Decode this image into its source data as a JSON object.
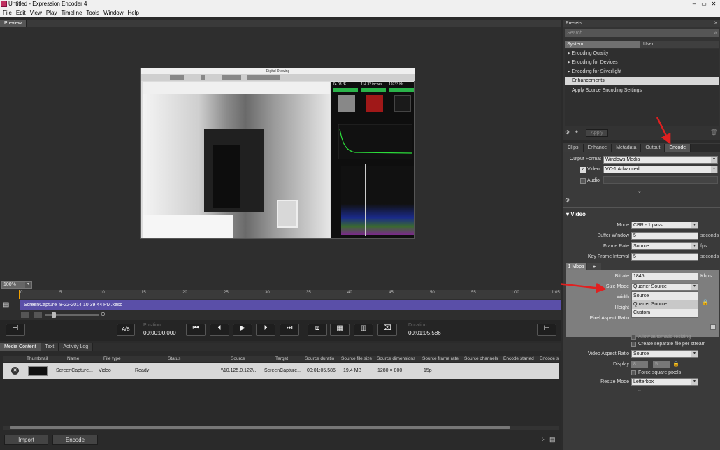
{
  "app": {
    "title": "Untitled - Expression Encoder 4"
  },
  "window_controls": {
    "minimize": "–",
    "maximize": "▭",
    "close": "✕"
  },
  "menu": [
    "File",
    "Edit",
    "View",
    "Play",
    "Timeline",
    "Tools",
    "Window",
    "Help"
  ],
  "preview": {
    "tab_label": "Preview",
    "inner_window_title": "Digital Drawing",
    "readouts": [
      "74.03 °F",
      "114.32 inches",
      "19733 Hz"
    ]
  },
  "presets": {
    "panel_title": "Presets",
    "search_placeholder": "Search",
    "tabs": [
      "System",
      "User"
    ],
    "items": [
      {
        "label": "Encoding Quality",
        "arrow": "▸"
      },
      {
        "label": "Encoding for Devices",
        "arrow": "▸"
      },
      {
        "label": "Encoding for Silverlight",
        "arrow": "▸"
      },
      {
        "label": "Enhancements",
        "arrow": ""
      },
      {
        "label": "Apply Source Encoding Settings",
        "arrow": ""
      }
    ],
    "apply_label": "Apply"
  },
  "encode_panel": {
    "tabs": [
      "Clips",
      "Enhance",
      "Metadata",
      "Output",
      "Encode"
    ],
    "output_format_label": "Output Format",
    "output_format_value": "Windows Media",
    "video_label": "Video",
    "video_codec": "VC-1 Advanced",
    "audio_label": "Audio",
    "video_section": "Video",
    "mode_label": "Mode",
    "mode_value": "CBR - 1 pass",
    "buffer_window_label": "Buffer Window",
    "buffer_window_value": "5",
    "buffer_window_unit": "seconds",
    "frame_rate_label": "Frame Rate",
    "frame_rate_value": "Source",
    "frame_rate_unit": "fps",
    "key_frame_label": "Key Frame Interval",
    "key_frame_value": "5",
    "key_frame_unit": "seconds",
    "bitrate_tab": "1 Mbps",
    "add_tab": "+",
    "bitrate_label": "Bitrate",
    "bitrate_value": "1845",
    "bitrate_unit": "Kbps",
    "size_mode_label": "Size Mode",
    "size_mode_value": "Quarter Source",
    "size_mode_options": [
      "Source",
      "Quarter Source",
      "Custom"
    ],
    "width_label": "Width",
    "height_label": "Height",
    "par_label": "Pixel Aspect Ratio",
    "allow_resizing": "Allow automatic resizing",
    "separate_file": "Create separate file per stream",
    "var_label": "Video Aspect Ratio",
    "var_value": "Source",
    "display_label": "Display",
    "display_w": "8",
    "display_h": "5",
    "force_square": "Force square pixels",
    "resize_mode_label": "Resize Mode",
    "resize_mode_value": "Letterbox"
  },
  "timeline": {
    "zoom": "100%",
    "clip_name": "ScreenCapture_8-22-2014 10.39.44 PM.xesc",
    "ticks": [
      "0",
      "5",
      "10",
      "15",
      "20",
      "25",
      "30",
      "35",
      "40",
      "45",
      "50",
      "55",
      "1:00",
      "1:05"
    ],
    "ab_label": "A/B",
    "position_label": "Position",
    "position_value": "00:00:00.000",
    "duration_label": "Duration",
    "duration_value": "00:01:05.586"
  },
  "media_content": {
    "tabs": [
      "Media Content",
      "Text",
      "Activity Log"
    ],
    "columns": [
      "Thumbnail",
      "Name",
      "File type",
      "Status",
      "Source",
      "Target",
      "Source duratio",
      "Source file size",
      "Source dimensions",
      "Source frame rate",
      "Source channels",
      "Encode started",
      "Encode s"
    ],
    "rows": [
      {
        "name": "ScreenCapture...",
        "file_type": "Video",
        "status": "Ready",
        "source": "\\\\10.125.0.122\\...",
        "target": "ScreenCapture...",
        "duration": "00:01:05.586",
        "size": "19.4 MB",
        "dimensions": "1280 × 800",
        "frame_rate": "15p"
      }
    ],
    "import_label": "Import",
    "encode_label": "Encode"
  },
  "colors": {
    "accent_red": "#e02020",
    "clip_purple": "#5a4fa8",
    "selected_row": "#d8d8d8"
  }
}
